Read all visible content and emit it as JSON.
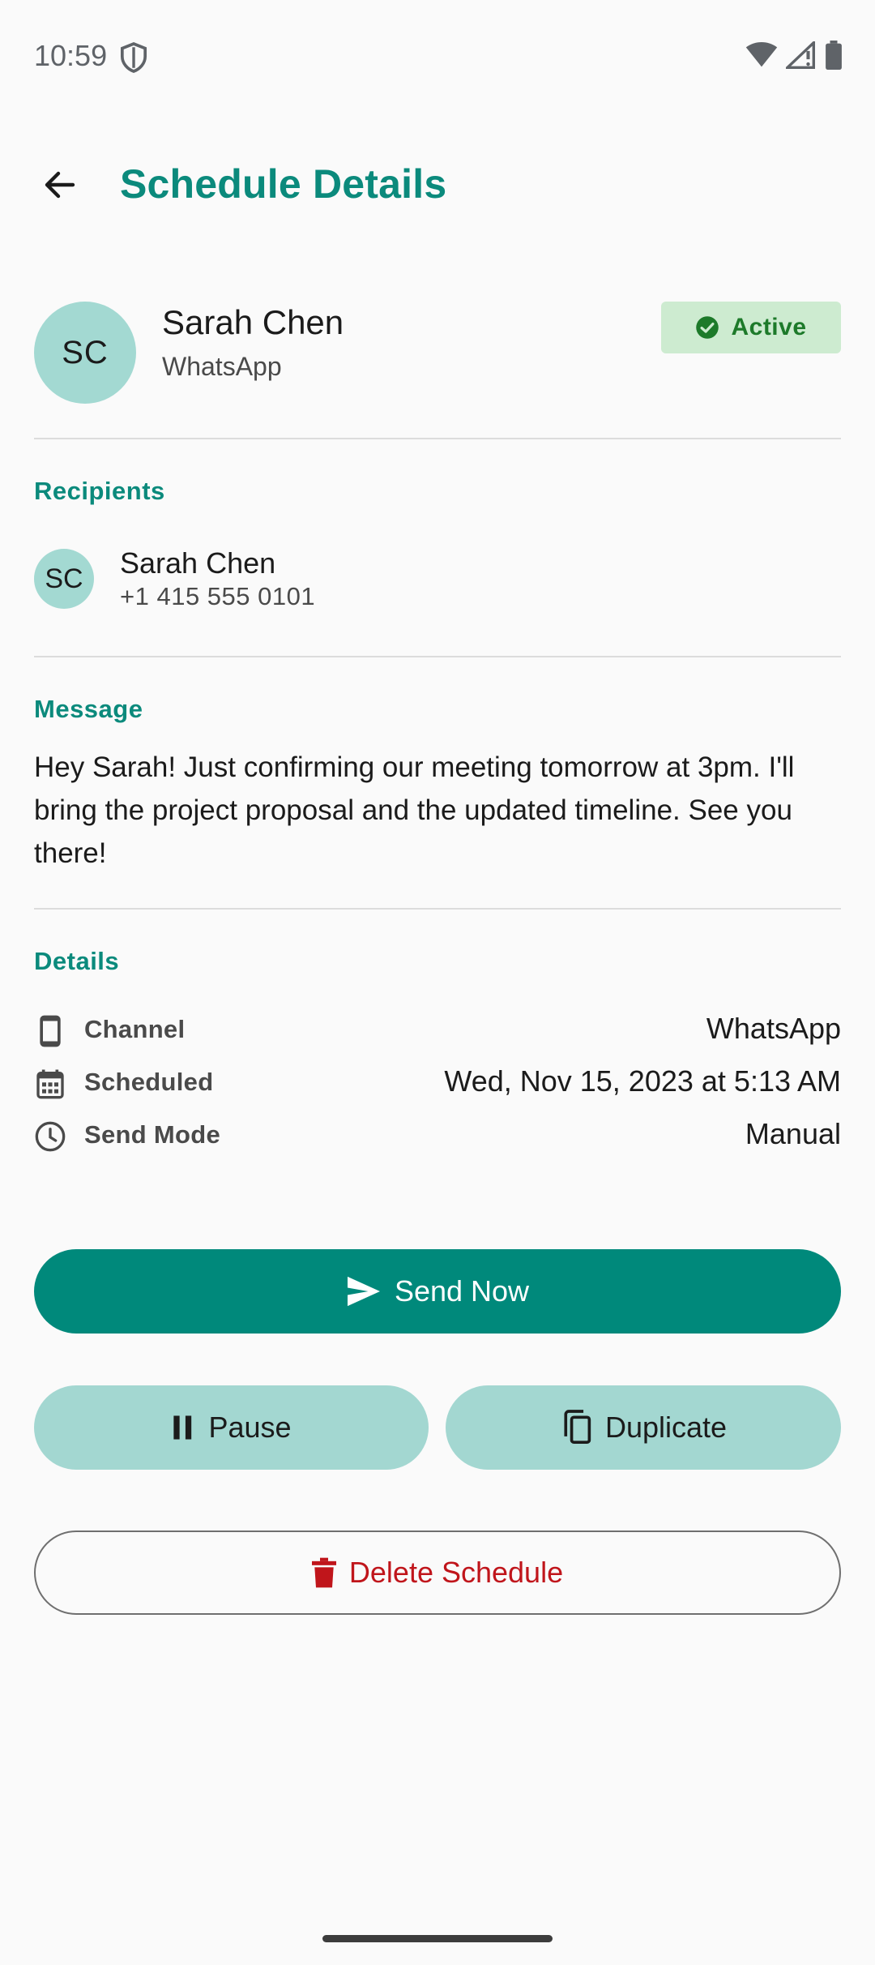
{
  "status_bar": {
    "time": "10:59"
  },
  "header": {
    "title": "Schedule Details"
  },
  "contact": {
    "initials": "SC",
    "name": "Sarah Chen",
    "channel": "WhatsApp",
    "status": "Active"
  },
  "recipients": {
    "title": "Recipients",
    "items": [
      {
        "initials": "SC",
        "name": "Sarah Chen",
        "phone": "+1 415 555 0101"
      }
    ]
  },
  "message": {
    "title": "Message",
    "text": "Hey Sarah! Just confirming our meeting tomorrow at 3pm. I'll bring the project proposal and the updated timeline. See you there!"
  },
  "details": {
    "title": "Details",
    "rows": [
      {
        "icon": "phone-icon",
        "label": "Channel",
        "value": "WhatsApp"
      },
      {
        "icon": "calendar-icon",
        "label": "Scheduled",
        "value": "Wed, Nov 15, 2023 at 5:13 AM"
      },
      {
        "icon": "clock-icon",
        "label": "Send Mode",
        "value": "Manual"
      }
    ]
  },
  "actions": {
    "send_now": "Send Now",
    "pause": "Pause",
    "duplicate": "Duplicate",
    "delete": "Delete Schedule"
  },
  "colors": {
    "accent": "#0b8a7c",
    "primary_button": "#00897b",
    "tonal_button": "#a3d7d1",
    "avatar": "#a3d9d2",
    "active_badge_bg": "#cdebd0",
    "active_badge_fg": "#1d7a2a",
    "danger": "#c0151b"
  }
}
